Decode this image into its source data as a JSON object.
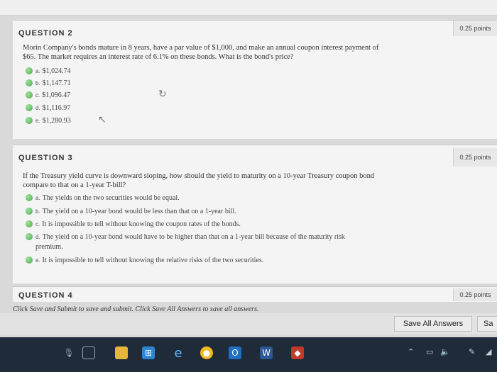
{
  "questions": [
    {
      "title": "QUESTION 2",
      "points": "0.25 points",
      "text_line1": "Morin Company's bonds mature in 8 years, have a par value of $1,000, and make an annual coupon interest payment of",
      "text_line2": "$65. The market requires an interest rate of 6.1% on these bonds. What is the bond's price?",
      "options": [
        {
          "letter": "a.",
          "text": "$1,024.74"
        },
        {
          "letter": "b.",
          "text": "$1,147.71"
        },
        {
          "letter": "c.",
          "text": "$1,096.47"
        },
        {
          "letter": "d.",
          "text": "$1,116.97"
        },
        {
          "letter": "e.",
          "text": "$1,280.93"
        }
      ]
    },
    {
      "title": "QUESTION 3",
      "points": "0.25 points",
      "text_line1": "If the Treasury yield curve is downward sloping, how should the yield to maturity on a 10-year Treasury coupon bond",
      "text_line2": "compare to that on a 1-year T-bill?",
      "options": [
        {
          "letter": "a.",
          "text": "The yields on the two securities would be equal."
        },
        {
          "letter": "b.",
          "text": "The yield on a 10-year bond would be less than that on a 1-year bill."
        },
        {
          "letter": "c.",
          "text": "It is impossible to tell without knowing the coupon rates of the bonds."
        },
        {
          "letter": "d.",
          "text": "The yield on a 10-year bond would have to be higher than that on a 1-year bill because of the maturity risk"
        },
        {
          "letter": "",
          "text": "premium."
        },
        {
          "letter": "e.",
          "text": "It is impossible to tell without knowing the relative risks of the two securities."
        }
      ]
    },
    {
      "title": "QUESTION 4",
      "points": "0.25 points"
    }
  ],
  "top_points": "0.25 points",
  "instructions": "Click Save and Submit to save and submit. Click Save All Answers to save all answers.",
  "buttons": {
    "save_all": "Save All Answers",
    "save_submit": "Sa"
  },
  "taskbar": {
    "icons": [
      "microphone-icon",
      "task-view-icon",
      "file-explorer-icon",
      "store-icon",
      "edge-icon",
      "chrome-icon",
      "outlook-icon",
      "word-icon",
      "red-app-icon"
    ],
    "colors": {
      "chrome": "#f2b825",
      "outlook": "#1f6fc5",
      "word": "#2b5797",
      "red": "#c0392b",
      "edge": "#2c86d4",
      "store": "#2c86d4"
    }
  }
}
